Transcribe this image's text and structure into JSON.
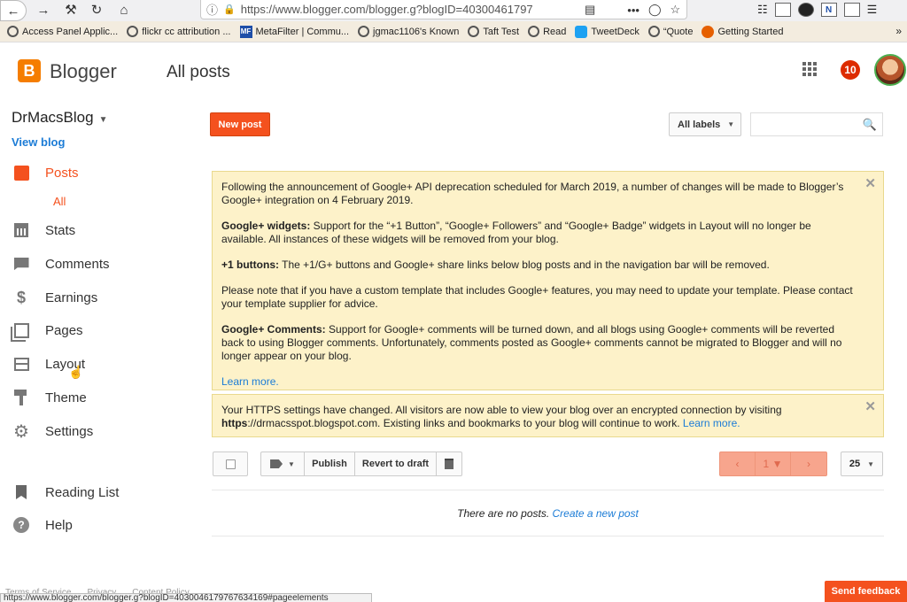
{
  "browser": {
    "url": "https://www.blogger.com/blogger.g?blogID=40300461797",
    "bookmarks": [
      {
        "label": "Access Panel Applic..."
      },
      {
        "label": "flickr cc attribution ..."
      },
      {
        "label": "MetaFilter | Commu..."
      },
      {
        "label": "jgmac1106's Known"
      },
      {
        "label": "Taft Test"
      },
      {
        "label": "Read"
      },
      {
        "label": "TweetDeck"
      },
      {
        "label": "“Quote"
      },
      {
        "label": "Getting Started"
      }
    ],
    "ext_label": "N"
  },
  "header": {
    "logo_letter": "B",
    "brand": "Blogger",
    "page_title": "All posts",
    "notification_count": "10"
  },
  "sidebar": {
    "blog_name": "DrMacsBlog",
    "view_blog": "View blog",
    "items": [
      {
        "label": "Posts",
        "icon": "posts-icon",
        "active": true
      },
      {
        "label": "Stats",
        "icon": "stats-icon"
      },
      {
        "label": "Comments",
        "icon": "comments-icon"
      },
      {
        "label": "Earnings",
        "icon": "dollar-icon"
      },
      {
        "label": "Pages",
        "icon": "pages-icon"
      },
      {
        "label": "Layout",
        "icon": "layout-icon"
      },
      {
        "label": "Theme",
        "icon": "theme-icon"
      },
      {
        "label": "Settings",
        "icon": "gear-icon"
      },
      {
        "label": "Reading List",
        "icon": "bookmark-icon"
      },
      {
        "label": "Help",
        "icon": "help-icon"
      }
    ],
    "sub_all": "All"
  },
  "toolbar": {
    "new_post": "New post",
    "all_labels": "All labels",
    "search_placeholder": ""
  },
  "notice1": {
    "p1": "Following the announcement of Google+ API deprecation scheduled for March 2019, a number of changes will be made to Blogger’s Google+ integration on 4 February 2019.",
    "p2_bold": "Google+ widgets:",
    "p2": " Support for the “+1 Button”, “Google+ Followers” and “Google+ Badge” widgets in Layout will no longer be available. All instances of these widgets will be removed from your blog.",
    "p3_bold": "+1 buttons:",
    "p3": " The +1/G+ buttons and Google+ share links below blog posts and in the navigation bar will be removed.",
    "p4": "Please note that if you have a custom template that includes Google+ features, you may need to update your template. Please contact your template supplier for advice.",
    "p5_bold": "Google+ Comments:",
    "p5": " Support for Google+ comments will be turned down, and all blogs using Google+ comments will be reverted back to using Blogger comments. Unfortunately, comments posted as Google+ comments cannot be migrated to Blogger and will no longer appear on your blog.",
    "learn_more": "Learn more."
  },
  "notice2": {
    "text1": "Your HTTPS settings have changed. All visitors are now able to view your blog over an encrypted connection by visiting ",
    "url_bold": "https",
    "text2": "://drmacsspot.blogspot.com. Existing links and bookmarks to your blog will continue to work. ",
    "learn_more": "Learn more."
  },
  "actions": {
    "publish": "Publish",
    "revert": "Revert to draft",
    "page_num": "1",
    "per_page": "25"
  },
  "empty": {
    "text": "There are no posts. ",
    "link": "Create a new post"
  },
  "footer": {
    "links": [
      "Terms of Service",
      "Privacy",
      "Content Policy"
    ],
    "status_url": "https://www.blogger.com/blogger.g?blogID=4030046179767634169#pageelements",
    "send_feedback": "Send feedback"
  },
  "colors": {
    "accent": "#f4511e",
    "link": "#1c7cd6",
    "notice_bg": "#fdf2c9"
  }
}
